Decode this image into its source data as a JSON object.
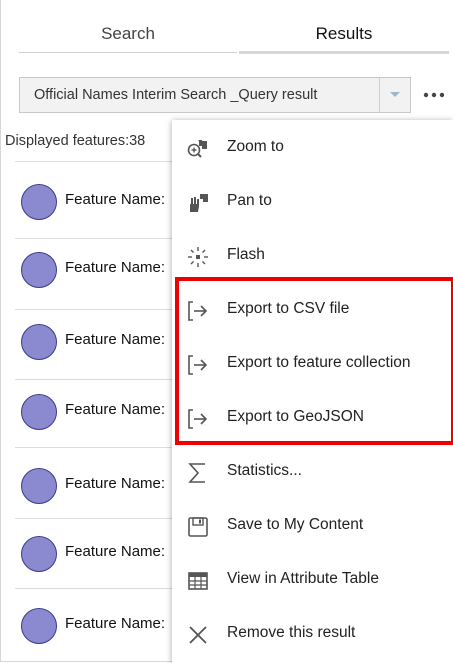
{
  "tabs": {
    "search": "Search",
    "results": "Results"
  },
  "result_select": {
    "value": "Official Names Interim Search _Query result"
  },
  "status": {
    "displayed": "Displayed features:38"
  },
  "rows": [
    {
      "label": "Feature Name:"
    },
    {
      "label": "Feature Name:"
    },
    {
      "label": "Feature Name:"
    },
    {
      "label": "Feature Name:"
    },
    {
      "label": "Feature Name:"
    },
    {
      "label": "Feature Name:"
    },
    {
      "label": "Feature Name:"
    }
  ],
  "menu": {
    "items": [
      {
        "label": "Zoom to",
        "icon": "zoom-to-icon"
      },
      {
        "label": "Pan to",
        "icon": "pan-to-icon"
      },
      {
        "label": "Flash",
        "icon": "flash-icon"
      },
      {
        "label": "Export to CSV file",
        "icon": "export-icon"
      },
      {
        "label": "Export to feature collection",
        "icon": "export-icon"
      },
      {
        "label": "Export to GeoJSON",
        "icon": "export-icon"
      },
      {
        "label": "Statistics...",
        "icon": "sigma-icon"
      },
      {
        "label": "Save to My Content",
        "icon": "save-icon"
      },
      {
        "label": "View in Attribute Table",
        "icon": "table-icon"
      },
      {
        "label": "Remove this result",
        "icon": "close-icon"
      }
    ]
  },
  "colors": {
    "avatar_fill": "#8b8ad0",
    "highlight_border": "#ee0000",
    "icon": "#555555"
  }
}
